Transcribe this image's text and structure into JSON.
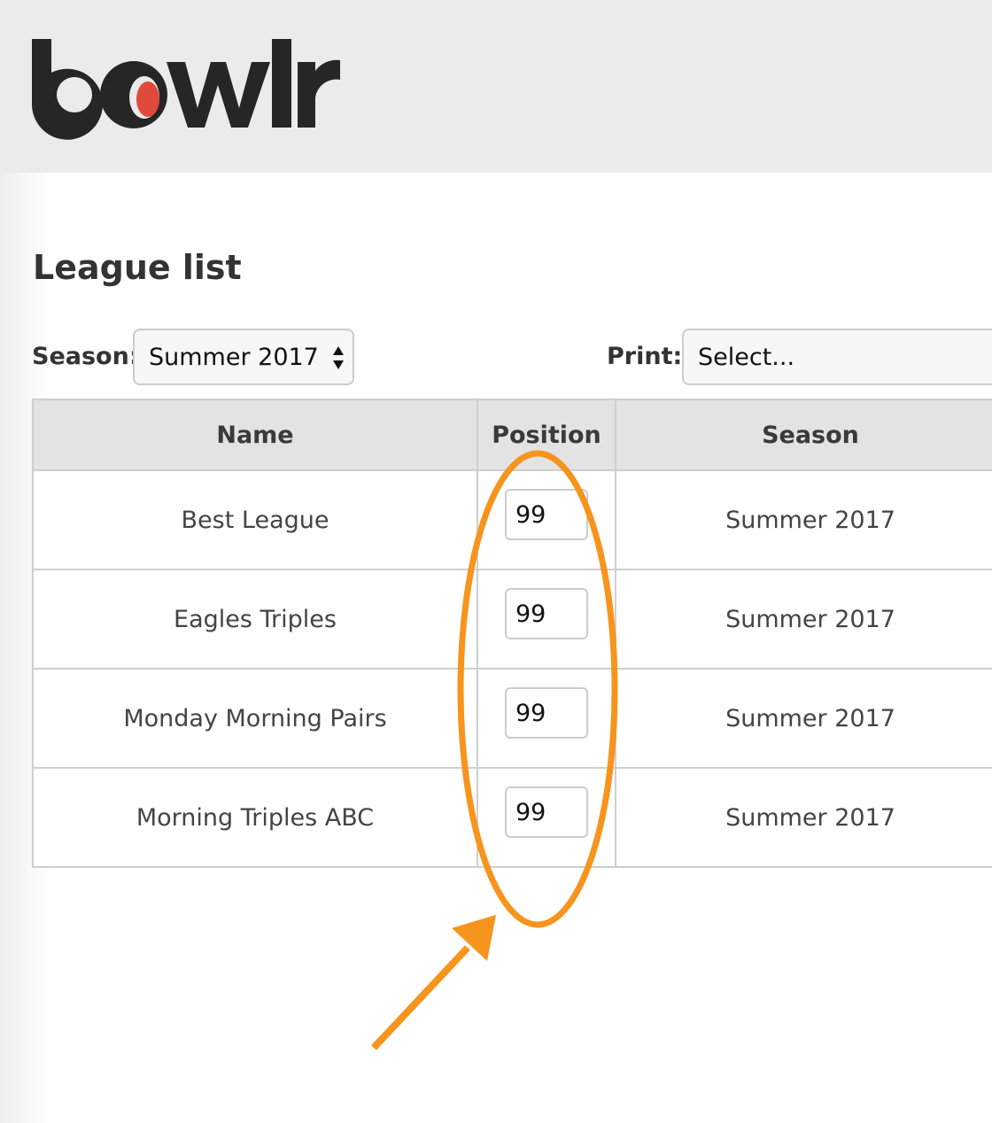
{
  "header": {
    "logo_text": "bowlr",
    "logo_ball_accent": "#e04a3a"
  },
  "page": {
    "title": "League list"
  },
  "filters": {
    "season_label": "Season:",
    "season_value": "Summer 2017",
    "print_label": "Print:",
    "print_value": "Select..."
  },
  "table": {
    "headers": {
      "name": "Name",
      "position": "Position",
      "season": "Season"
    },
    "rows": [
      {
        "name": "Best League",
        "position": "99",
        "season": "Summer 2017"
      },
      {
        "name": "Eagles Triples",
        "position": "99",
        "season": "Summer 2017"
      },
      {
        "name": "Monday Morning Pairs",
        "position": "99",
        "season": "Summer 2017"
      },
      {
        "name": "Morning Triples ABC",
        "position": "99",
        "season": "Summer 2017"
      }
    ]
  },
  "annotation": {
    "color": "#f7941d",
    "shapes": [
      "ellipse-highlight",
      "arrow"
    ]
  }
}
